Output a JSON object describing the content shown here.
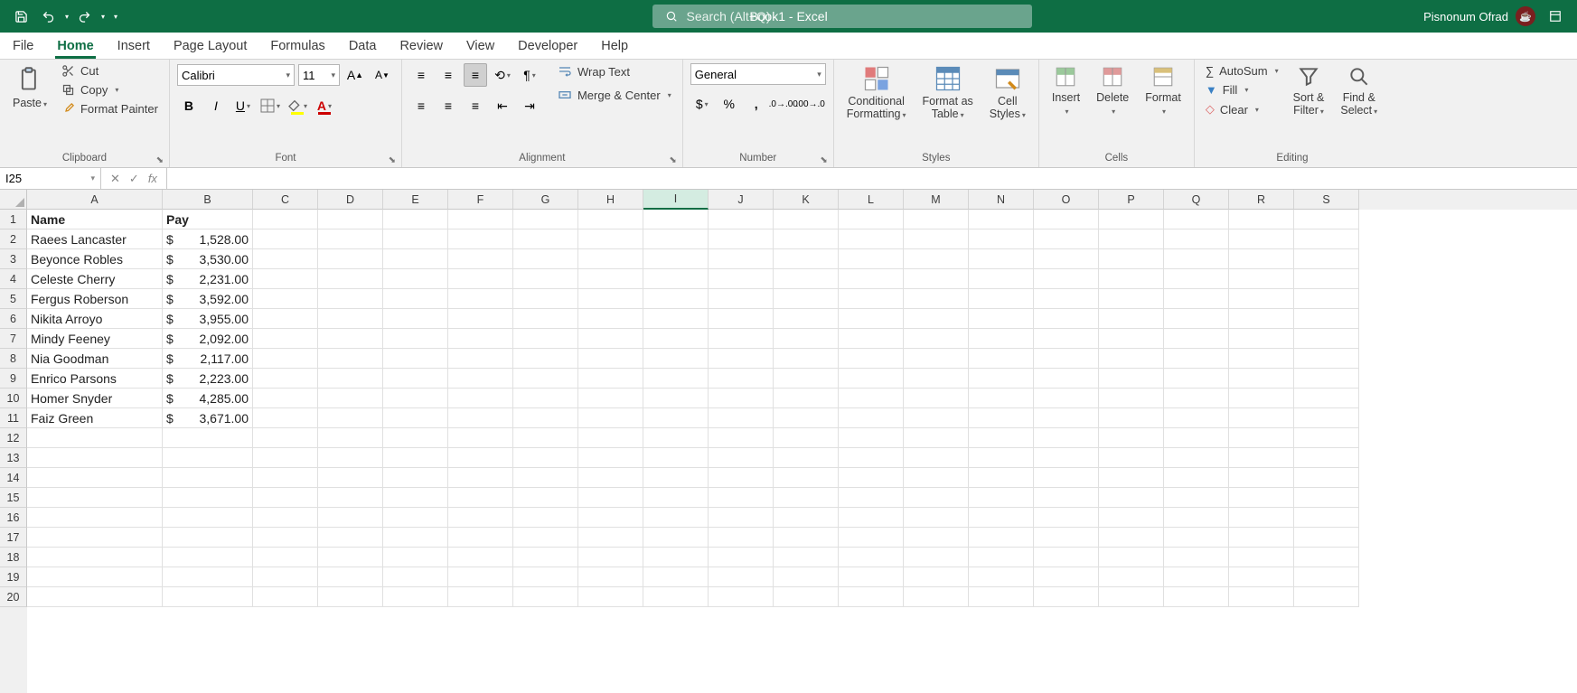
{
  "title": "Book1 - Excel",
  "search_placeholder": "Search (Alt+Q)",
  "user_name": "Pisnonum Ofrad",
  "tabs": [
    "File",
    "Home",
    "Insert",
    "Page Layout",
    "Formulas",
    "Data",
    "Review",
    "View",
    "Developer",
    "Help"
  ],
  "active_tab": "Home",
  "clipboard": {
    "paste": "Paste",
    "cut": "Cut",
    "copy": "Copy",
    "painter": "Format Painter",
    "label": "Clipboard"
  },
  "font": {
    "name": "Calibri",
    "size": "11",
    "label": "Font"
  },
  "alignment": {
    "wrap": "Wrap Text",
    "merge": "Merge & Center",
    "label": "Alignment"
  },
  "number": {
    "format": "General",
    "label": "Number"
  },
  "styles": {
    "cond": "Conditional\nFormatting",
    "table": "Format as\nTable",
    "cell": "Cell\nStyles",
    "label": "Styles"
  },
  "cells": {
    "insert": "Insert",
    "delete": "Delete",
    "format": "Format",
    "label": "Cells"
  },
  "editing": {
    "autosum": "AutoSum",
    "fill": "Fill",
    "clear": "Clear",
    "sort": "Sort &\nFilter",
    "find": "Find &\nSelect",
    "label": "Editing"
  },
  "namebox": "I25",
  "columns": [
    "A",
    "B",
    "C",
    "D",
    "E",
    "F",
    "G",
    "H",
    "I",
    "J",
    "K",
    "L",
    "M",
    "N",
    "O",
    "P",
    "Q",
    "R",
    "S"
  ],
  "col_widths": {
    "A": 150,
    "B": 100,
    "default": 72
  },
  "active_col": "I",
  "row_count": 20,
  "headers": {
    "A": "Name",
    "B": "Pay"
  },
  "data": [
    {
      "name": "Raees Lancaster",
      "pay": "1,528.00"
    },
    {
      "name": "Beyonce Robles",
      "pay": "3,530.00"
    },
    {
      "name": "Celeste Cherry",
      "pay": "2,231.00"
    },
    {
      "name": "Fergus Roberson",
      "pay": "3,592.00"
    },
    {
      "name": "Nikita Arroyo",
      "pay": "3,955.00"
    },
    {
      "name": "Mindy Feeney",
      "pay": "2,092.00"
    },
    {
      "name": "Nia Goodman",
      "pay": "2,117.00"
    },
    {
      "name": "Enrico Parsons",
      "pay": "2,223.00"
    },
    {
      "name": "Homer Snyder",
      "pay": "4,285.00"
    },
    {
      "name": "Faiz Green",
      "pay": "3,671.00"
    }
  ]
}
